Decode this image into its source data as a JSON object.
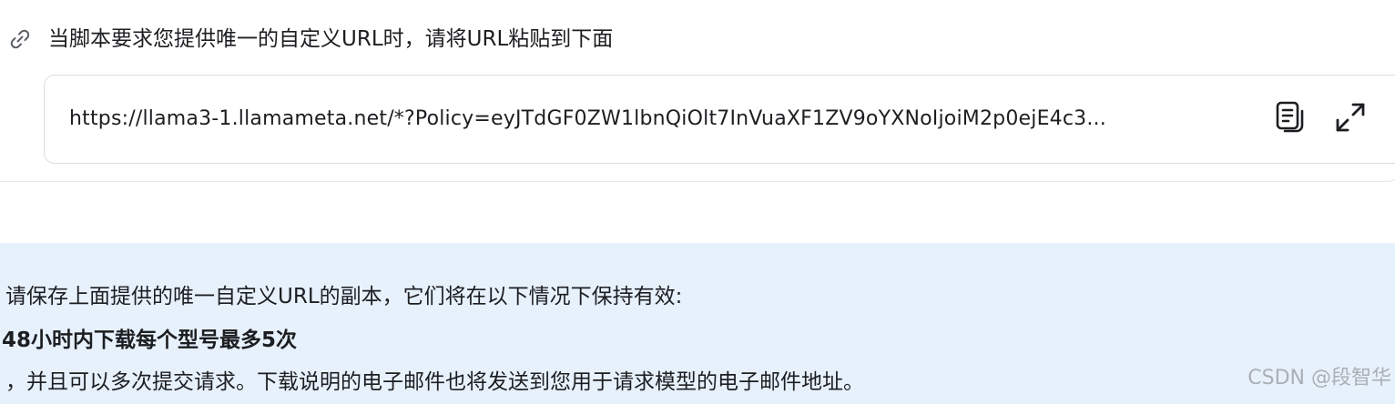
{
  "instruction": {
    "icon": "link-icon",
    "text": "当脚本要求您提供唯一的自定义URL时，请将URL粘贴到下面"
  },
  "url_field": {
    "value": "https://llama3-1.llamameta.net/*?Policy=eyJTdGF0ZW1lbnQiOlt7InVuaXF1ZV9oYXNoIjoiM2p0ejE4c3...",
    "copy_icon": "copy-icon",
    "expand_icon": "expand-icon"
  },
  "notice": {
    "line1": "请保存上面提供的唯一自定义URL的副本，它们将在以下情况下保持有效:",
    "bold_line": "48小时内下载每个型号最多5次",
    "line3": "，并且可以多次提交请求。下载说明的电子邮件也将发送到您用于请求模型的电子邮件地址。"
  },
  "watermark": "CSDN @段智华",
  "colors": {
    "notice_background": "#e7f1fc",
    "text": "#1c1e21",
    "border": "#dadde1"
  }
}
